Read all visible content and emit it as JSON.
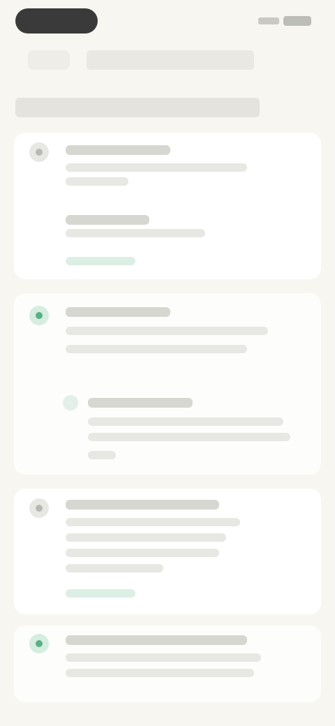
{
  "status_bar": {
    "time_pill": "",
    "signal_icon": "signal-icon",
    "battery_icon": "battery-icon"
  },
  "nav": {
    "back_label": "",
    "title": ""
  },
  "section": {
    "heading": ""
  },
  "steps": [
    {
      "state": "pending",
      "title": "",
      "lines": [
        "",
        ""
      ],
      "sub_title": "",
      "sub_line": "",
      "link": ""
    },
    {
      "state": "done",
      "title": "",
      "lines": [
        "",
        ""
      ],
      "sub_title": "",
      "sub_lines": [
        "",
        "",
        ""
      ]
    },
    {
      "state": "pending",
      "title": "",
      "lines": [
        "",
        "",
        "",
        ""
      ],
      "link": ""
    },
    {
      "state": "done",
      "title": "",
      "lines": [
        "",
        ""
      ]
    }
  ],
  "colors": {
    "background": "#f7f6f1",
    "card": "#ffffff",
    "accent_green": "#5bb083",
    "muted_text": "#8b8b86"
  }
}
